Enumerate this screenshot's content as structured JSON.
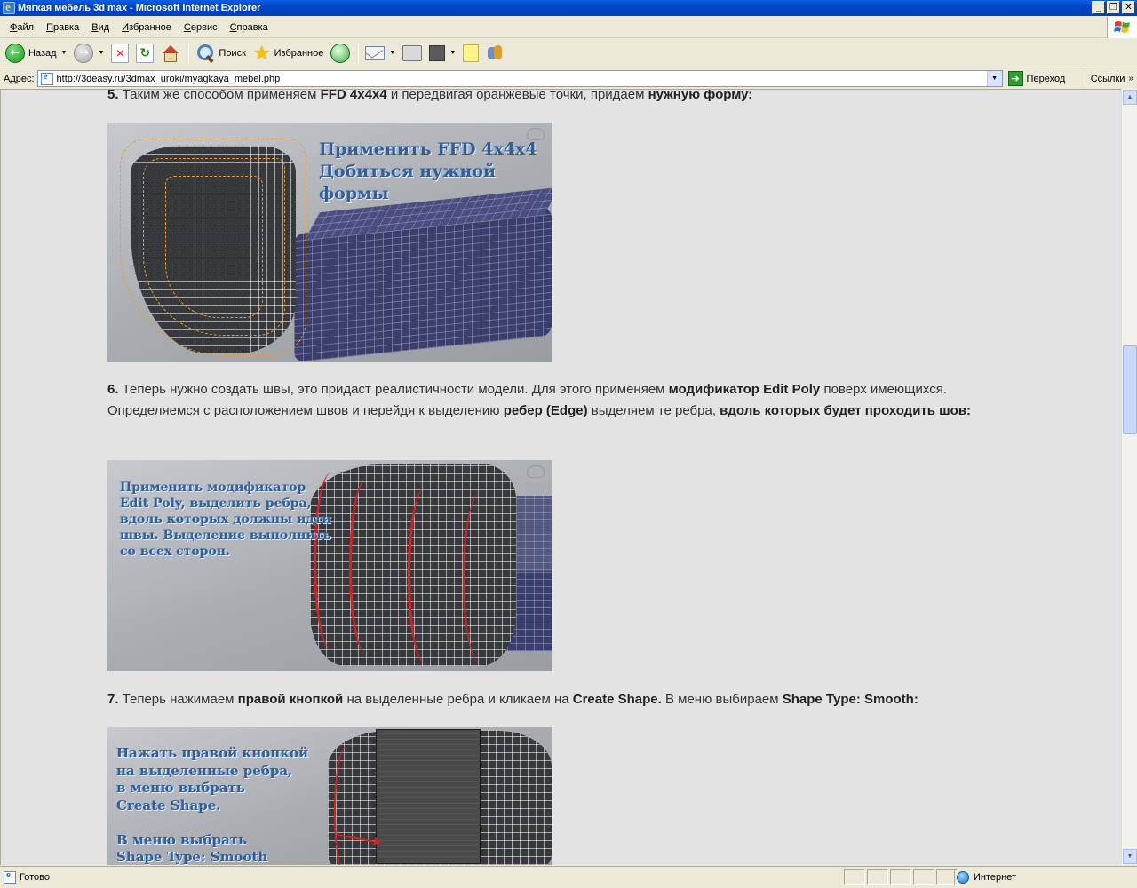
{
  "window": {
    "title": "Мягкая мебель 3d max - Microsoft Internet Explorer",
    "buttons": {
      "minimize": "_",
      "maximize": "❐",
      "close": "✕"
    }
  },
  "menu": [
    {
      "label": "Файл"
    },
    {
      "label": "Правка"
    },
    {
      "label": "Вид"
    },
    {
      "label": "Избранное"
    },
    {
      "label": "Сервис"
    },
    {
      "label": "Справка"
    }
  ],
  "toolbar": {
    "back_label": "Назад",
    "search_label": "Поиск",
    "favorites_label": "Избранное"
  },
  "address": {
    "label": "Адрес:",
    "url": "http://3deasy.ru/3dmax_uroki/myagkaya_mebel.php",
    "go_label": "Переход",
    "links_label": "Ссылки"
  },
  "content": {
    "step5": {
      "num": "5.",
      "t1": " Таким же способом применяем ",
      "b1": "FFD 4x4x4",
      "t2": " и передвигая оранжевые точки, придаем ",
      "b2": "нужную форму:"
    },
    "image1_caption": "Применить FFD 4x4x4\nДобиться нужной формы",
    "step6": {
      "num": "6.",
      "t1": " Теперь нужно создать швы, это придаст реалистичности модели. Для этого применяем ",
      "b1": "модификатор Edit Poly",
      "t2": " поверх имеющихся. Определяемся с расположением швов и перейдя к выделению ",
      "b2": "ребер (Edge)",
      "t3": " выделяем те ребра, ",
      "b3": "вдоль которых будет проходить шов:"
    },
    "image2_caption": "Применить модификатор\nEdit Poly, выделить ребра,\nвдоль которых должны идти\nшвы. Выделение выполнить\nсо всех сторон.",
    "step7": {
      "num": "7.",
      "t1": " Теперь нажимаем ",
      "b1": "правой кнопкой",
      "t2": " на выделенные ребра и кликаем на ",
      "b2": "Create Shape.",
      "t3": " В меню выбираем ",
      "b3": "Shape Type: Smooth:"
    },
    "image3_caption": "Нажать правой кнопкой\nна выделенные ребра,\nв меню выбрать\nCreate Shape.\n\nВ меню выбрать\nShape Type: Smooth"
  },
  "status": {
    "text": "Готово",
    "zone": "Интернет"
  },
  "colors": {
    "page_bg": "#e3e3e3",
    "text": "#333333",
    "caption_blue": "#335e96",
    "seam_red": "#e02020",
    "ffd_orange": "#f09a2a"
  }
}
